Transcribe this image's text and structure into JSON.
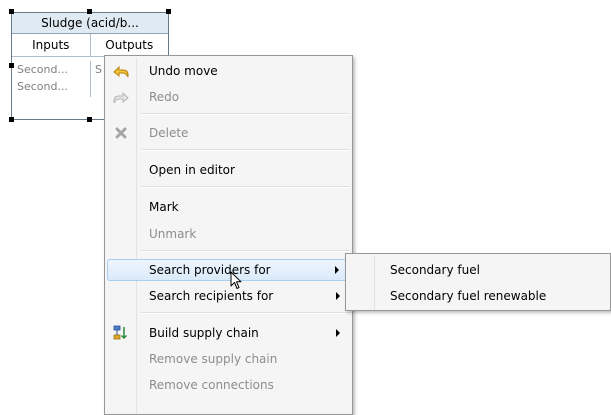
{
  "node": {
    "title": "Sludge (acid/b...",
    "inputs_header": "Inputs",
    "outputs_header": "Outputs",
    "inputs": [
      "Second...",
      "Second..."
    ],
    "outputs": [
      "S"
    ]
  },
  "menu": {
    "undo_move": {
      "label": "Undo move",
      "icon": "undo-arrow-icon"
    },
    "redo": {
      "label": "Redo",
      "icon": "redo-arrow-icon"
    },
    "delete": {
      "label": "Delete",
      "icon": "delete-x-icon"
    },
    "open_in_editor": {
      "label": "Open in editor"
    },
    "mark": {
      "label": "Mark"
    },
    "unmark": {
      "label": "Unmark"
    },
    "search_providers": {
      "label": "Search providers for"
    },
    "search_recipients": {
      "label": "Search recipients for"
    },
    "build_supply_chain": {
      "label": "Build supply chain",
      "icon": "supply-chain-icon"
    },
    "remove_supply_chain": {
      "label": "Remove supply chain"
    },
    "remove_connections": {
      "label": "Remove connections"
    }
  },
  "submenu": {
    "items": [
      "Secondary fuel",
      "Secondary fuel renewable"
    ]
  },
  "colors": {
    "node_header": "#dfeaf2",
    "menu_bg": "#f5f5f5",
    "hover_border": "#a8cff0",
    "undo_icon": "#e0a820",
    "disabled_text": "#8d8d8d"
  }
}
